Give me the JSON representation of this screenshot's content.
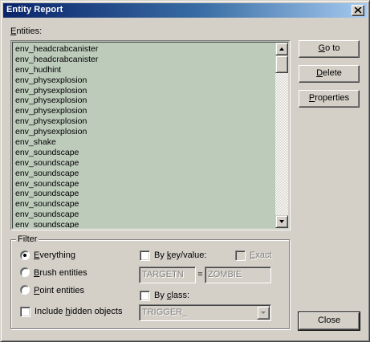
{
  "window": {
    "title": "Entity Report"
  },
  "entities": {
    "label": "Entities:",
    "items": [
      "env_headcrabcanister",
      "env_headcrabcanister",
      "env_hudhint",
      "env_physexplosion",
      "env_physexplosion",
      "env_physexplosion",
      "env_physexplosion",
      "env_physexplosion",
      "env_physexplosion",
      "env_shake",
      "env_soundscape",
      "env_soundscape",
      "env_soundscape",
      "env_soundscape",
      "env_soundscape",
      "env_soundscape",
      "env_soundscape",
      "env_soundscape"
    ]
  },
  "buttons": {
    "goto": "Go to",
    "delete": "Delete",
    "properties": "Properties",
    "close": "Close"
  },
  "filter": {
    "title": "Filter",
    "everything": "Everything",
    "brush": "Brush entities",
    "point": "Point entities",
    "include_hidden": "Include hidden objects",
    "by_key_value": "By key/value:",
    "exact": "Exact",
    "key": "TARGETN",
    "equals": "=",
    "value": "ZOMBIE",
    "by_class": "By class:",
    "class_value": "TRIGGER_"
  },
  "colors": {
    "list_bg": "#bdcbbb",
    "title_start": "#0a246a",
    "title_end": "#a6caf0"
  }
}
